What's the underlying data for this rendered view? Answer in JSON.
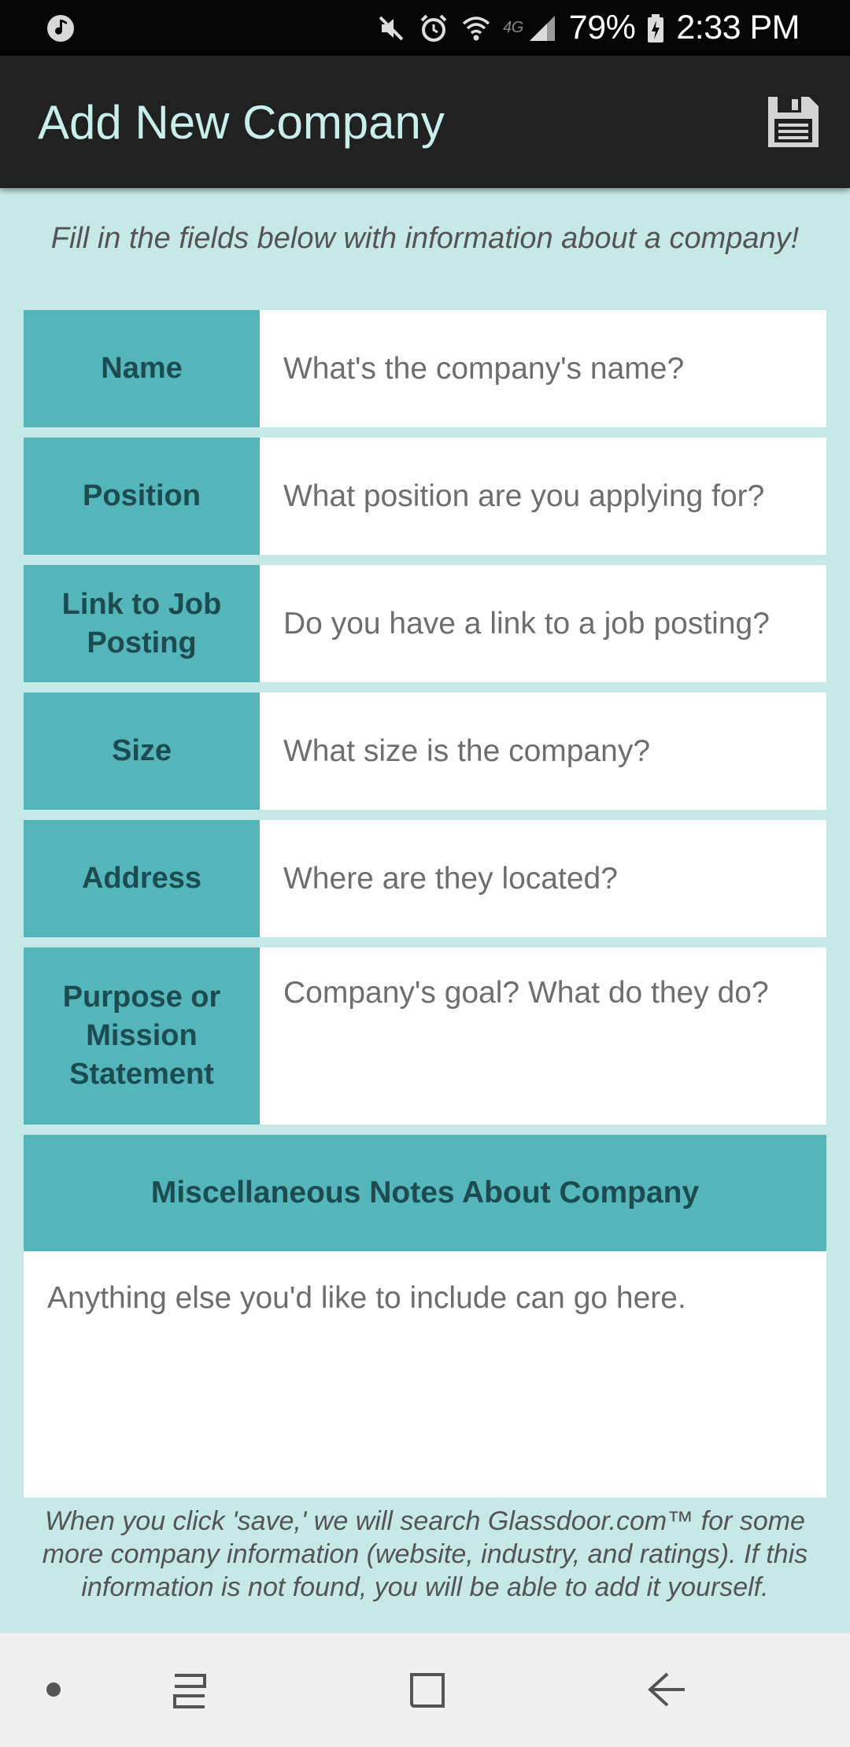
{
  "status_bar": {
    "network_label": "4G",
    "battery": "79%",
    "time": "2:33 PM",
    "icons": [
      "music-icon",
      "mute-icon",
      "alarm-icon",
      "wifi-icon",
      "signal-icon",
      "battery-icon"
    ]
  },
  "app_bar": {
    "title": "Add New Company",
    "save_icon": "save-icon"
  },
  "form": {
    "intro": "Fill in the fields below with information about a company!",
    "rows": [
      {
        "label": "Name",
        "placeholder": "What's the company's name?"
      },
      {
        "label": "Position",
        "placeholder": "What position are you applying for?"
      },
      {
        "label": "Link to Job Posting",
        "placeholder": "Do you have a link to a job posting?"
      },
      {
        "label": "Size",
        "placeholder": "What size is the company?"
      },
      {
        "label": "Address",
        "placeholder": "Where are they located?"
      },
      {
        "label": "Purpose or Mission Statement",
        "placeholder": "Company's goal? What do they do?"
      }
    ],
    "misc": {
      "label": "Miscellaneous Notes About Company",
      "placeholder": "Anything else you'd like to include can go here."
    },
    "footnote": "When you click 'save,' we will search Glassdoor.com™ for some more company information (website, industry, and ratings). If this information is not found, you will be able to add it yourself."
  },
  "nav_bar": {
    "icons": [
      "dot-icon",
      "recents-icon",
      "home-icon",
      "back-icon"
    ]
  },
  "colors": {
    "background": "#c6e9e8",
    "label_bg": "#54b5bb",
    "label_text": "#1c4b50",
    "app_bar": "#212121",
    "title_text": "#c9efec"
  }
}
